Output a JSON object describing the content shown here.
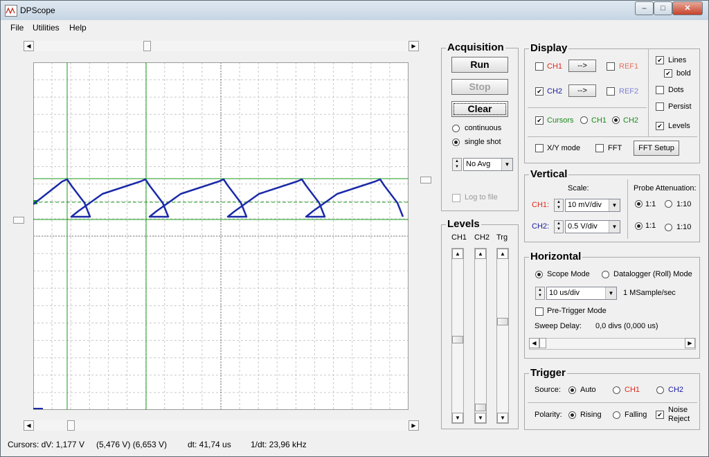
{
  "window": {
    "title": "DPScope",
    "minimize": "‒",
    "maximize": "□",
    "close": "✕"
  },
  "menu": {
    "file": "File",
    "utilities": "Utilities",
    "help": "Help"
  },
  "acquisition": {
    "title": "Acquisition",
    "run": "Run",
    "stop": "Stop",
    "clear": "Clear",
    "continuous": "continuous",
    "single_shot": "single shot",
    "avg_value": "No Avg",
    "log_to_file": "Log to file"
  },
  "display": {
    "title": "Display",
    "ch1": "CH1",
    "ch2": "CH2",
    "ref1": "REF1",
    "ref2": "REF2",
    "arrow": "-->",
    "cursors": "Cursors",
    "cursor_ch1": "CH1",
    "cursor_ch2": "CH2",
    "xy_mode": "X/Y mode",
    "fft": "FFT",
    "fft_setup": "FFT Setup",
    "lines": "Lines",
    "bold": "bold",
    "dots": "Dots",
    "persist": "Persist",
    "levels": "Levels"
  },
  "vertical": {
    "title": "Vertical",
    "scale_label": "Scale:",
    "ch1_label": "CH1:",
    "ch1_scale": "10 mV/div",
    "ch2_label": "CH2:",
    "ch2_scale": "0.5 V/div",
    "probe_label": "Probe Attenuation:",
    "ratio_1_1": "1:1",
    "ratio_1_10": "1:10"
  },
  "horizontal": {
    "title": "Horizontal",
    "scope_mode": "Scope Mode",
    "datalogger_mode": "Datalogger (Roll) Mode",
    "timebase": "10 us/div",
    "sample_rate": "1 MSample/sec",
    "pretrigger": "Pre-Trigger Mode",
    "sweep_delay_label": "Sweep Delay:",
    "sweep_delay_value": "0,0 divs (0,000 us)"
  },
  "levels": {
    "title": "Levels",
    "ch1": "CH1",
    "ch2": "CH2",
    "trg": "Trg",
    "up": "▲",
    "down": "▼"
  },
  "trigger": {
    "title": "Trigger",
    "source_label": "Source:",
    "auto": "Auto",
    "ch1": "CH1",
    "ch2": "CH2",
    "polarity_label": "Polarity:",
    "rising": "Rising",
    "falling": "Falling",
    "noise_reject": "Noise\nReject"
  },
  "status": {
    "cursors": "Cursors: dV: 1,177 V",
    "levels": "(5,476 V) (6,653 V)",
    "dt": "dt: 41,74 us",
    "freq": "1/dt: 23,96 kHz"
  },
  "scroll": {
    "left": "◀",
    "right": "▶"
  },
  "colors": {
    "ch1": "#e0281c",
    "ch2": "#1a1aa0",
    "trace": "#1a2aa8",
    "cursor": "#1a9a1a",
    "ref1": "#e07060",
    "ref2": "#8080d8",
    "trg": "#1a8a1a"
  }
}
